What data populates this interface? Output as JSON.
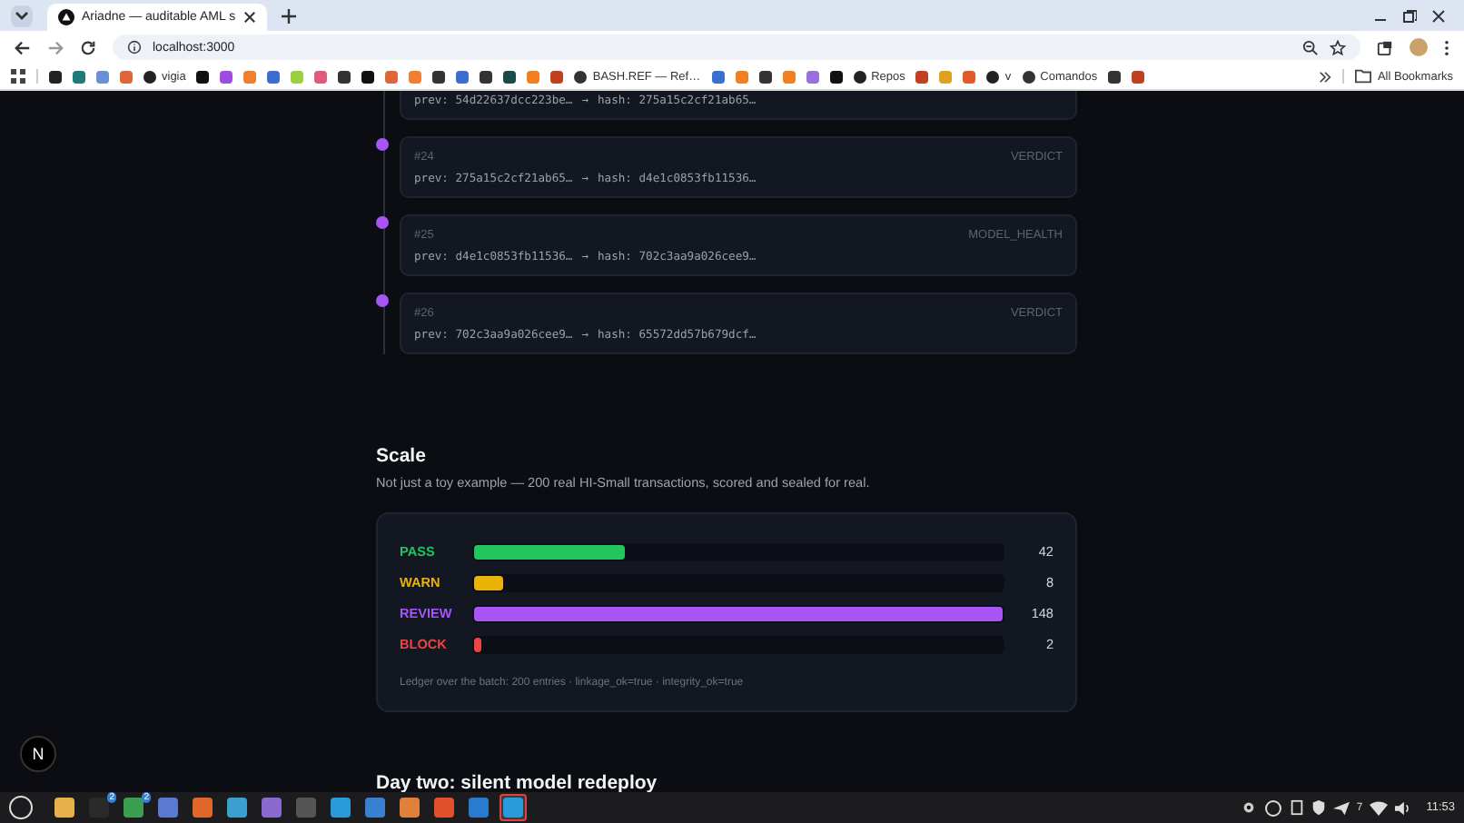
{
  "browser": {
    "tab_title": "Ariadne — auditable AML s",
    "address": "localhost:3000",
    "bookmarks": [
      {
        "kind": "icon",
        "color": "#222222"
      },
      {
        "kind": "icon",
        "color": "#1f7a7a"
      },
      {
        "kind": "icon",
        "color": "#6b8fd6"
      },
      {
        "kind": "icon",
        "color": "#e0663a"
      },
      {
        "kind": "labeled",
        "label": "vigia",
        "color": "#222222"
      },
      {
        "kind": "icon",
        "color": "#111111"
      },
      {
        "kind": "icon",
        "color": "#a04be0"
      },
      {
        "kind": "icon",
        "color": "#f08030"
      },
      {
        "kind": "icon",
        "color": "#3a6fd0"
      },
      {
        "kind": "icon",
        "color": "#9ad040"
      },
      {
        "kind": "icon",
        "color": "#e05a7a"
      },
      {
        "kind": "icon",
        "color": "#333333"
      },
      {
        "kind": "icon",
        "color": "#111111"
      },
      {
        "kind": "icon",
        "color": "#e0663a"
      },
      {
        "kind": "icon",
        "color": "#f08030"
      },
      {
        "kind": "icon",
        "color": "#333333"
      },
      {
        "kind": "icon",
        "color": "#3a6fd0"
      },
      {
        "kind": "icon",
        "color": "#333333"
      },
      {
        "kind": "icon",
        "color": "#1a4a4a"
      },
      {
        "kind": "icon",
        "color": "#f08020"
      },
      {
        "kind": "icon",
        "color": "#c04020"
      },
      {
        "kind": "labeled",
        "label": "BASH.REF — Ref…",
        "color": "#333333"
      },
      {
        "kind": "icon",
        "color": "#3a6fd0"
      },
      {
        "kind": "icon",
        "color": "#f08020"
      },
      {
        "kind": "icon",
        "color": "#333333"
      },
      {
        "kind": "icon",
        "color": "#f08020"
      },
      {
        "kind": "icon",
        "color": "#9a6fe0"
      },
      {
        "kind": "icon",
        "color": "#111111"
      },
      {
        "kind": "labeled",
        "label": "Repos",
        "color": "#222222"
      },
      {
        "kind": "icon",
        "color": "#c04020"
      },
      {
        "kind": "icon",
        "color": "#e0a020"
      },
      {
        "kind": "icon",
        "color": "#e05a2a"
      },
      {
        "kind": "labeled",
        "label": "v",
        "color": "#222222"
      },
      {
        "kind": "labeled",
        "label": "Comandos",
        "color": "#333333"
      },
      {
        "kind": "icon",
        "color": "#333333"
      },
      {
        "kind": "icon",
        "color": "#c04020"
      }
    ],
    "all_bookmarks": "All Bookmarks"
  },
  "ledger": [
    {
      "prev": "prev: 54d22637dcc223be…",
      "arrow": "→",
      "hash": "hash: 275a15c2cf21ab65…"
    },
    {
      "index": "#24",
      "type": "VERDICT",
      "prev": "prev: 275a15c2cf21ab65…",
      "arrow": "→",
      "hash": "hash: d4e1c0853fb11536…"
    },
    {
      "index": "#25",
      "type": "MODEL_HEALTH",
      "prev": "prev: d4e1c0853fb11536…",
      "arrow": "→",
      "hash": "hash: 702c3aa9a026cee9…"
    },
    {
      "index": "#26",
      "type": "VERDICT",
      "prev": "prev: 702c3aa9a026cee9…",
      "arrow": "→",
      "hash": "hash: 65572dd57b679dcf…"
    }
  ],
  "scale": {
    "title": "Scale",
    "subtitle": "Not just a toy example — 200 real HI-Small transactions, scored and sealed for real.",
    "rows": [
      {
        "label": "PASS",
        "color": "#22c55e",
        "level": 0.284,
        "count": "42"
      },
      {
        "label": "WARN",
        "color": "#eab308",
        "level": 0.054,
        "count": "8"
      },
      {
        "label": "REVIEW",
        "color": "#a855f7",
        "level": 1,
        "count": "148"
      },
      {
        "label": "BLOCK",
        "color": "#ef4444",
        "level": 0.014,
        "count": "2"
      }
    ],
    "footer": "Ledger over the batch: 200 entries · linkage_ok=true · integrity_ok=true"
  },
  "next_heading": "Day two: silent model redeploy",
  "dev_badge": "N",
  "taskbar": {
    "apps": [
      {
        "color": "#e8b04a",
        "selected": false
      },
      {
        "color": "#2a2a2a",
        "badge": "2",
        "selected": false
      },
      {
        "color": "#3aa050",
        "badge": "2",
        "selected": false
      },
      {
        "color": "#5a7ad0",
        "selected": false
      },
      {
        "color": "#e0662a",
        "selected": false
      },
      {
        "color": "#3aa0d0",
        "selected": false
      },
      {
        "color": "#8a6ad0",
        "selected": false
      },
      {
        "color": "#555555",
        "selected": false
      },
      {
        "color": "#2a9ad8",
        "selected": false
      },
      {
        "color": "#3a80d0",
        "selected": false
      },
      {
        "color": "#e0803a",
        "selected": false
      },
      {
        "color": "#e0502a",
        "selected": false
      },
      {
        "color": "#2a7ad0",
        "selected": false
      },
      {
        "color": "#2a9ad8",
        "selected": true
      }
    ],
    "notifications": "7",
    "clock": "11:53"
  }
}
